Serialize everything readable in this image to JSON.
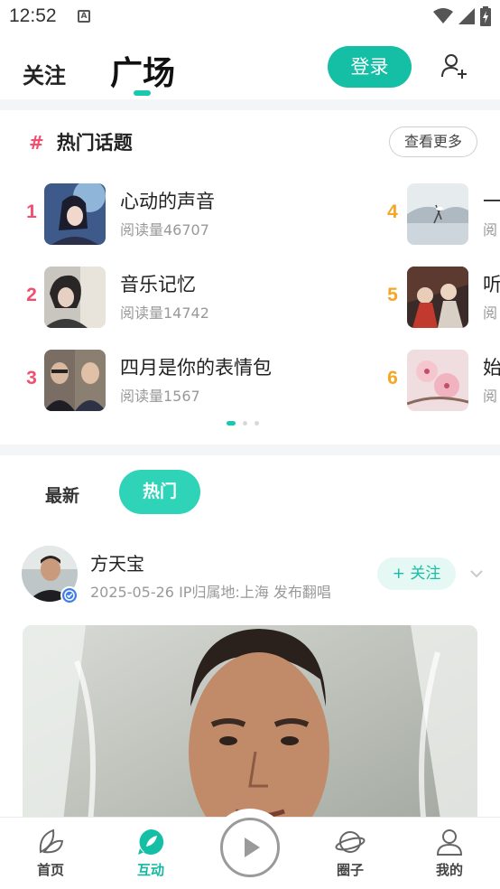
{
  "status_bar": {
    "time": "12:52",
    "sim_label": "A",
    "icons": [
      "wifi-icon",
      "signal-icon",
      "battery-charging-icon"
    ]
  },
  "header": {
    "tab_follow": "关注",
    "tab_square": "广场",
    "login_label": "登录",
    "add_user_icon": "add-user-icon",
    "accent_color": "#14bfa5"
  },
  "hot_topics": {
    "hash": "#",
    "title": "热门话题",
    "more_label": "查看更多",
    "items": [
      {
        "rank": "1",
        "title": "心动的声音",
        "reads": "阅读量46707",
        "rank_color": "#f0506e"
      },
      {
        "rank": "2",
        "title": "音乐记忆",
        "reads": "阅读量14742",
        "rank_color": "#f0506e"
      },
      {
        "rank": "3",
        "title": "四月是你的表情包",
        "reads": "阅读量1567",
        "rank_color": "#f0506e"
      },
      {
        "rank": "4",
        "title": "一",
        "reads": "阅",
        "rank_color": "#f5a623"
      },
      {
        "rank": "5",
        "title": "听",
        "reads": "阅",
        "rank_color": "#f5a623"
      },
      {
        "rank": "6",
        "title": "始",
        "reads": "阅",
        "rank_color": "#f5a623"
      }
    ],
    "page_count": 3,
    "active_page": 1
  },
  "feed": {
    "tab_new": "最新",
    "tab_hot": "热门",
    "post": {
      "username": "方天宝",
      "meta": "2025-05-26 IP归属地:上海 发布翻唱",
      "follow_label": "+ 关注",
      "verified_icon": "verified-badge-icon",
      "expand_icon": "chevron-down-icon"
    }
  },
  "bottom_nav": {
    "items": [
      {
        "label": "首页",
        "icon": "leaf-icon",
        "active": false
      },
      {
        "label": "互动",
        "icon": "chat-leaf-icon",
        "active": true
      },
      {
        "label": "圈子",
        "icon": "planet-icon",
        "active": false
      },
      {
        "label": "我的",
        "icon": "user-icon",
        "active": false
      }
    ],
    "play_icon": "play-icon"
  }
}
